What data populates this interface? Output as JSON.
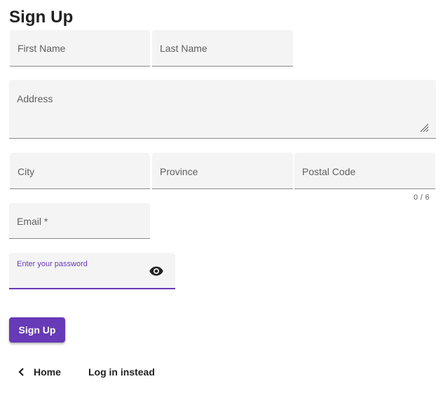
{
  "page": {
    "title": "Sign Up"
  },
  "form": {
    "first_name_label": "First Name",
    "last_name_label": "Last Name",
    "address_label": "Address",
    "city_label": "City",
    "province_label": "Province",
    "postal_code_label": "Postal Code",
    "postal_code_hint": "0 / 6",
    "email_label": "Email *",
    "password_label": "Enter your password",
    "password_toggle_icon": "eye-icon",
    "accent_color": "#673ab7"
  },
  "actions": {
    "sign_up_label": "Sign Up",
    "home_label": "Home",
    "home_icon": "chevron-left-icon",
    "login_label": "Log in instead"
  }
}
